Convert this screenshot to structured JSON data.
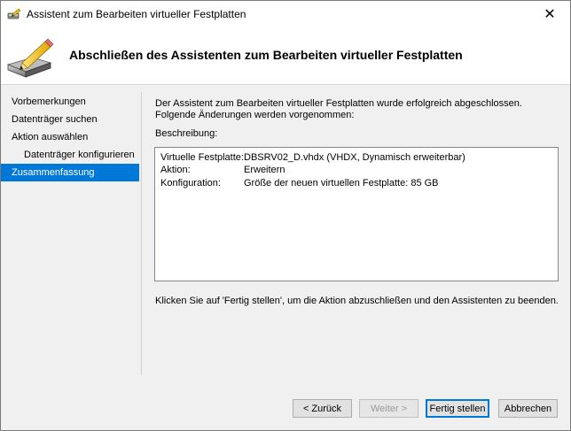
{
  "window": {
    "title": "Assistent zum Bearbeiten virtueller Festplatten",
    "close_glyph": "✕"
  },
  "header": {
    "heading": "Abschließen des Assistenten zum Bearbeiten virtueller Festplatten",
    "icon": "disk-pencil-icon"
  },
  "nav": {
    "items": [
      {
        "label": "Vorbemerkungen"
      },
      {
        "label": "Datenträger suchen"
      },
      {
        "label": "Aktion auswählen"
      },
      {
        "label": "Datenträger konfigurieren"
      },
      {
        "label": "Zusammenfassung"
      }
    ],
    "selected_color": "#0078d7"
  },
  "main": {
    "intro": "Der Assistent zum Bearbeiten virtueller Festplatten wurde erfolgreich abgeschlossen. Folgende Änderungen werden vorgenommen:",
    "description_label": "Beschreibung:",
    "summary": [
      {
        "key": "Virtuelle Festplatte:",
        "value": "DBSRV02_D.vhdx (VHDX, Dynamisch erweiterbar)"
      },
      {
        "key": "Aktion:",
        "value": "Erweitern"
      },
      {
        "key": "Konfiguration:",
        "value": "Größe der neuen virtuellen Festplatte: 85 GB"
      }
    ],
    "finish_text": "Klicken Sie auf 'Fertig stellen', um die Aktion abzuschließen und den Assistenten zu beenden."
  },
  "buttons": {
    "back": "< Zurück",
    "next": "Weiter >",
    "finish": "Fertig stellen",
    "cancel": "Abbrechen"
  }
}
